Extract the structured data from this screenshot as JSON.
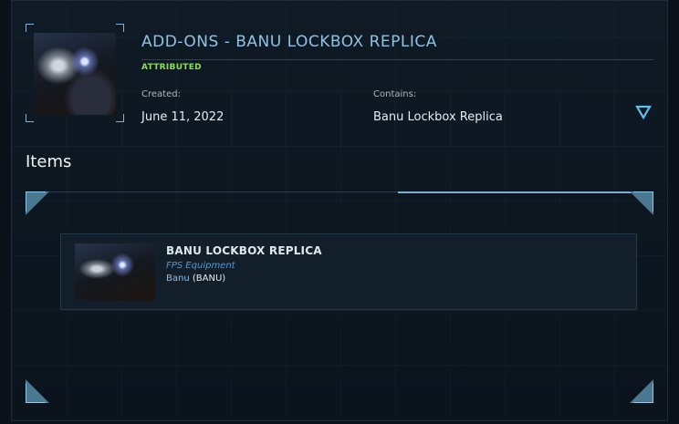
{
  "header": {
    "title": "ADD-ONS - BANU LOCKBOX REPLICA",
    "status": "ATTRIBUTED",
    "created_label": "Created:",
    "created_value": "June 11, 2022",
    "contains_label": "Contains:",
    "contains_value": "Banu Lockbox Replica"
  },
  "section": {
    "title": "Items"
  },
  "items": [
    {
      "title": "BANU LOCKBOX REPLICA",
      "type": "FPS Equipment",
      "manufacturer": "Banu",
      "manufacturer_code": "(BANU)"
    }
  ],
  "colors": {
    "accent": "#8fc3e3",
    "status": "#8ddf54",
    "link": "#4f9bd8",
    "background": "#0b1118"
  }
}
